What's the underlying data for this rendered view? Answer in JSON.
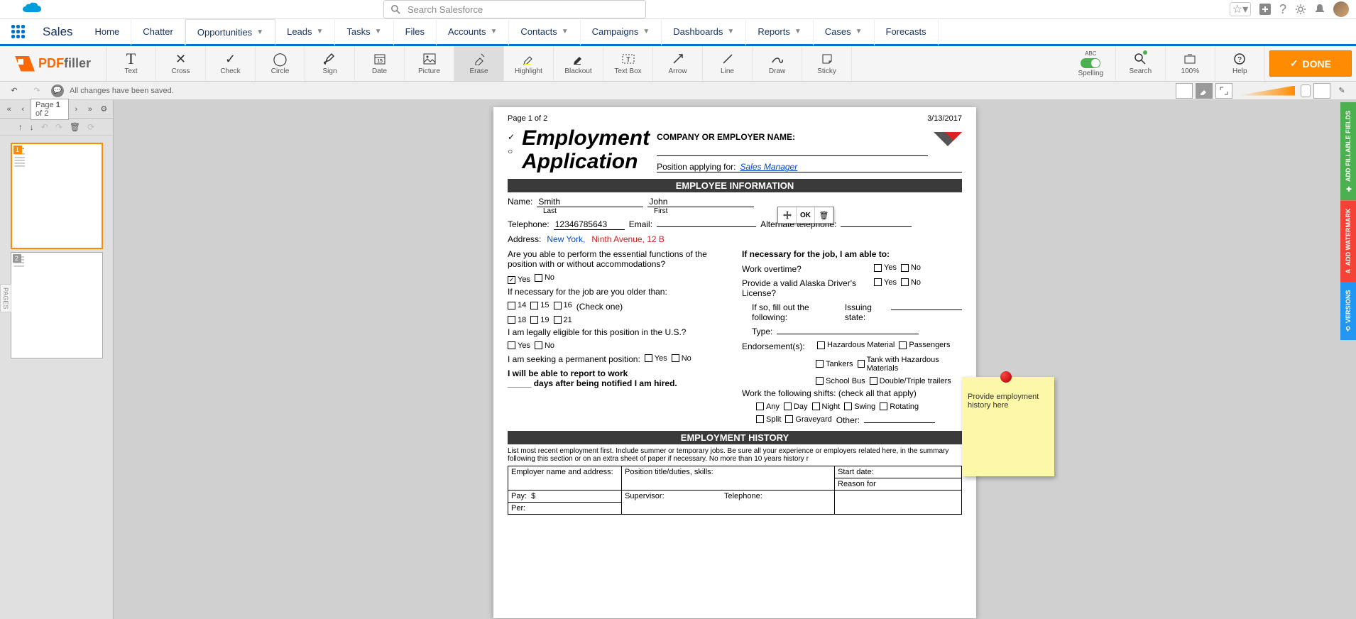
{
  "sf_header": {
    "search_placeholder": "Search Salesforce"
  },
  "sf_nav": {
    "app_name": "Sales",
    "items": [
      {
        "label": "Home"
      },
      {
        "label": "Chatter"
      },
      {
        "label": "Opportunities"
      },
      {
        "label": "Leads"
      },
      {
        "label": "Tasks"
      },
      {
        "label": "Files"
      },
      {
        "label": "Accounts"
      },
      {
        "label": "Contacts"
      },
      {
        "label": "Campaigns"
      },
      {
        "label": "Dashboards"
      },
      {
        "label": "Reports"
      },
      {
        "label": "Cases"
      },
      {
        "label": "Forecasts"
      }
    ]
  },
  "pdf_toolbar": {
    "logo_pdf": "PDF",
    "logo_filler": "filler",
    "tools": [
      {
        "label": "Text"
      },
      {
        "label": "Cross"
      },
      {
        "label": "Check"
      },
      {
        "label": "Circle"
      },
      {
        "label": "Sign"
      },
      {
        "label": "Date"
      },
      {
        "label": "Picture"
      },
      {
        "label": "Erase"
      },
      {
        "label": "Highlight"
      },
      {
        "label": "Blackout"
      },
      {
        "label": "Text Box"
      },
      {
        "label": "Arrow"
      },
      {
        "label": "Line"
      },
      {
        "label": "Draw"
      },
      {
        "label": "Sticky"
      }
    ],
    "right_tools": [
      {
        "label": "Spelling",
        "sub": "ABC"
      },
      {
        "label": "Search"
      },
      {
        "label": "100%"
      },
      {
        "label": "Help"
      }
    ],
    "done": "DONE"
  },
  "status": {
    "message": "All changes have been saved."
  },
  "thumbs": {
    "page_info_prefix": "Page ",
    "page_current": "1",
    "page_of": " of ",
    "page_total": "2"
  },
  "page": {
    "header_left": "Page 1 of 2",
    "header_right": "3/13/2017",
    "title_line1": "Employment",
    "title_line2": "Application",
    "company_label": "COMPANY OR EMPLOYER NAME:",
    "position_label": "Position applying for:",
    "position_value": "Sales Manager",
    "section_employee": "EMPLOYEE INFORMATION",
    "name_label": "Name:",
    "last_name": "Smith",
    "first_name": "John",
    "last_label": "Last",
    "first_label": "First",
    "tel_label": "Telephone:",
    "tel_value": "12346785643",
    "email_label": "Email:",
    "alt_tel_label": "Alternate telephone:",
    "address_label": "Address:",
    "address_city": "New York,",
    "address_rest": "Ninth Avenue, 12 B",
    "q1": "Are you able to perform the essential functions of the position with or without accommodations?",
    "yes": "Yes",
    "no": "No",
    "q2": "If necessary for the job are you older than:",
    "age14": "14",
    "age16": "16",
    "age18": "18",
    "age19": "19",
    "age21": "21",
    "age15": "15",
    "check_one": "(Check one)",
    "q3": "I am legally eligible for this position in the U.S.?",
    "q4": "I am seeking a permanent position:",
    "q5a": "I will be able to report to work",
    "q5b": "_____ days after being notified I am hired.",
    "r_title": "If necessary for the job, I am able to:",
    "r_overtime": "Work overtime?",
    "r_license": "Provide a valid Alaska Driver's License?",
    "r_ifso": "If so, fill out the following:",
    "r_state": "Issuing state:",
    "r_type": "Type:",
    "r_endorse": "Endorsement(s):",
    "r_haz": "Hazardous Material",
    "r_pass": "Passengers",
    "r_tank": "Tankers",
    "r_tankhaz": "Tank with Hazardous Materials",
    "r_bus": "School Bus",
    "r_trailer": "Double/Triple trailers",
    "r_shifts": "Work the following shifts: (check all that apply)",
    "s_any": "Any",
    "s_day": "Day",
    "s_night": "Night",
    "s_swing": "Swing",
    "s_rot": "Rotating",
    "s_split": "Split",
    "s_grave": "Graveyard",
    "s_other": "Other:",
    "section_history": "EMPLOYMENT HISTORY",
    "hist_text": "List most recent employment first. Include summer or temporary jobs. Be sure all your experience or employers related here, in the summary following this section or on an extra sheet of paper if necessary. No more than 10 years history r",
    "h_employer": "Employer name and address:",
    "h_position": "Position title/duties, skills:",
    "h_start": "Start date:",
    "h_reason": "Reason for",
    "h_pay": "Pay:",
    "h_dollar": "$",
    "h_per": "Per:",
    "h_super": "Supervisor:",
    "h_tel": "Telephone:",
    "sticky_text": "Provide employment history here",
    "field_ok": "OK"
  },
  "side_tabs": {
    "fillable": "ADD FILLABLE FIELDS",
    "watermark": "ADD WATERMARK",
    "versions": "VERSIONS"
  }
}
